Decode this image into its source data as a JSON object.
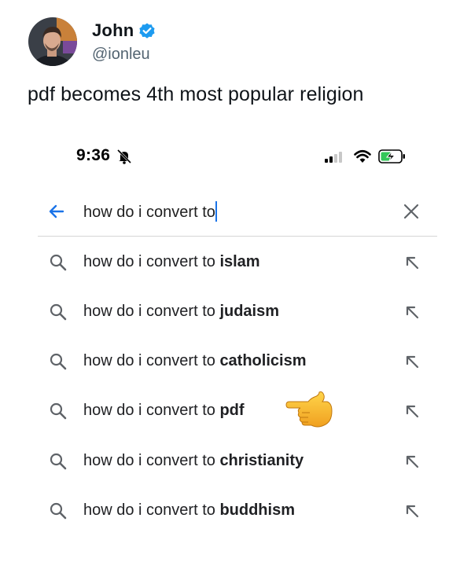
{
  "tweet": {
    "author_name": "John",
    "author_handle": "@ionleu",
    "text": "pdf becomes 4th most popular religion"
  },
  "status_bar": {
    "time": "9:36"
  },
  "search": {
    "query": "how do i convert to"
  },
  "suggestions": [
    {
      "prefix": "how do i convert to ",
      "completion": "islam"
    },
    {
      "prefix": "how do i convert to ",
      "completion": "judaism"
    },
    {
      "prefix": "how do i convert to ",
      "completion": "catholicism"
    },
    {
      "prefix": "how do i convert to ",
      "completion": "pdf"
    },
    {
      "prefix": "how do i convert to ",
      "completion": "christianity"
    },
    {
      "prefix": "how do i convert to ",
      "completion": "buddhism"
    }
  ],
  "colors": {
    "verified_blue": "#1d9bf0",
    "accent_blue": "#1a73e8",
    "battery_green": "#34c759",
    "icon_gray": "#5f6368"
  }
}
